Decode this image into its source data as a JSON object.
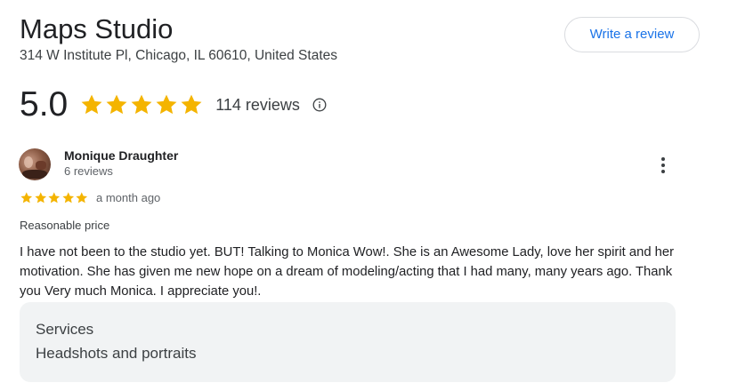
{
  "business": {
    "name": "Maps Studio",
    "address": "314 W Institute Pl, Chicago, IL 60610, United States",
    "write_review_label": "Write a review",
    "rating": "5.0",
    "rating_stars": 5,
    "review_count_label": "114 reviews"
  },
  "review": {
    "author": "Monique Draughter",
    "author_meta": "6 reviews",
    "stars": 5,
    "time": "a month ago",
    "tag": "Reasonable price",
    "text": "I have not been to the studio yet. BUT! Talking to Monica Wow!. She is an Awesome Lady, love her spirit and her motivation. She has given me new hope on a dream of modeling/acting that I had many, many years ago. Thank you Very much Monica. I appreciate you!.",
    "services": {
      "title": "Services",
      "value": "Headshots and portraits"
    }
  },
  "colors": {
    "star": "#f4b400",
    "accent": "#1a73e8",
    "services_bg": "#f1f3f4"
  },
  "icons": [
    "star-icon",
    "info-icon",
    "more-vert-icon"
  ]
}
